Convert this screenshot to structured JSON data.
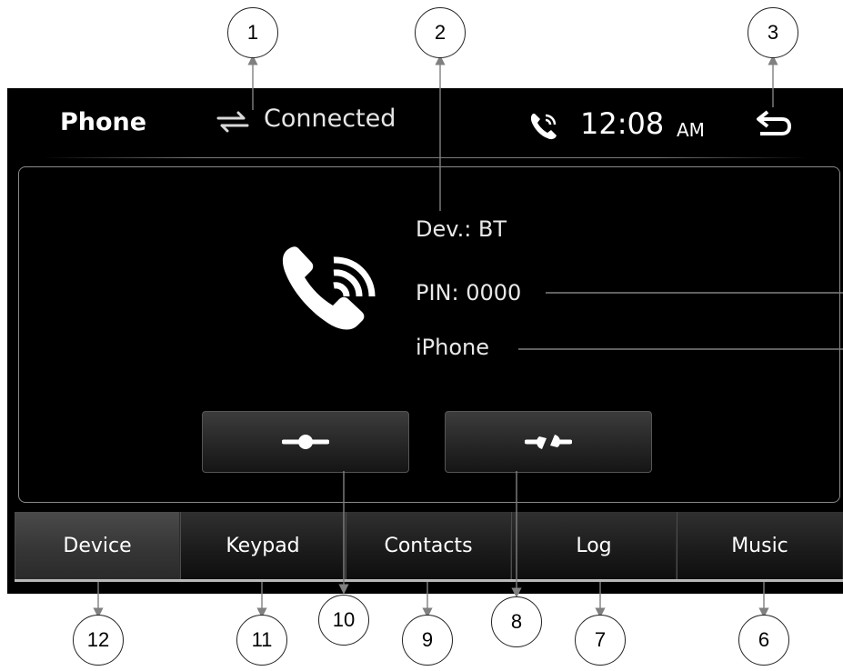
{
  "header": {
    "title": "Phone",
    "connection_status": "Connected",
    "time": "12:08",
    "ampm": "AM"
  },
  "device_info": {
    "device": "Dev.: BT",
    "pin": "PIN: 0000",
    "name": "iPhone"
  },
  "tabs": [
    {
      "label": "Device",
      "active": true
    },
    {
      "label": "Keypad",
      "active": false
    },
    {
      "label": "Contacts",
      "active": false
    },
    {
      "label": "Log",
      "active": false
    },
    {
      "label": "Music",
      "active": false
    }
  ],
  "callouts": [
    "1",
    "2",
    "3",
    "6",
    "7",
    "8",
    "9",
    "10",
    "11",
    "12"
  ],
  "icons": {
    "connection": "arrows-exchange-icon",
    "phone_status": "phone-signal-icon",
    "back": "back-arrow-icon",
    "device": "phone-bluetooth-icon",
    "connect_button": "connect-plug-icon",
    "disconnect_button": "disconnect-plug-icon"
  },
  "colors": {
    "screen_bg": "#000000",
    "text": "#ffffff",
    "panel_border": "#8a8a8a"
  }
}
